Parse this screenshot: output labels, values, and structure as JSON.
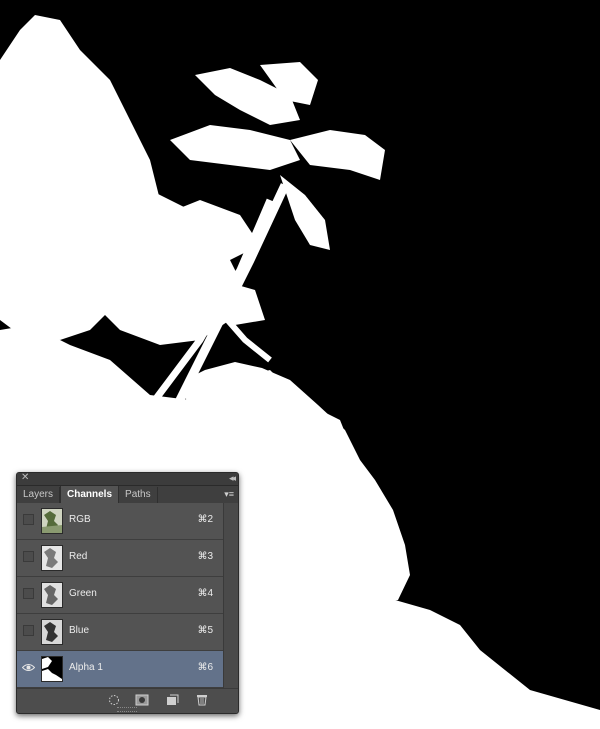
{
  "panel": {
    "close_glyph": "✕",
    "collapse_glyph": "◂◂",
    "menu_glyph": "▾≡",
    "tabs": [
      {
        "label": "Layers",
        "active": false
      },
      {
        "label": "Channels",
        "active": true
      },
      {
        "label": "Paths",
        "active": false
      }
    ],
    "channels": [
      {
        "name": "RGB",
        "shortcut": "⌘2",
        "visible": false,
        "selected": false,
        "thumb": "color"
      },
      {
        "name": "Red",
        "shortcut": "⌘3",
        "visible": false,
        "selected": false,
        "thumb": "gray-light"
      },
      {
        "name": "Green",
        "shortcut": "⌘4",
        "visible": false,
        "selected": false,
        "thumb": "gray-light"
      },
      {
        "name": "Blue",
        "shortcut": "⌘5",
        "visible": false,
        "selected": false,
        "thumb": "gray-dark"
      },
      {
        "name": "Alpha 1",
        "shortcut": "⌘6",
        "visible": true,
        "selected": true,
        "thumb": "mask"
      }
    ],
    "footer_icons": [
      "load-selection-icon",
      "save-selection-icon",
      "new-channel-icon",
      "trash-icon"
    ],
    "colors": {
      "panel": "#535353",
      "selected_row": "#63728a",
      "tab_bar": "#3f3f3f"
    }
  },
  "canvas": {
    "background": "#000000",
    "mask_color": "#ffffff"
  }
}
